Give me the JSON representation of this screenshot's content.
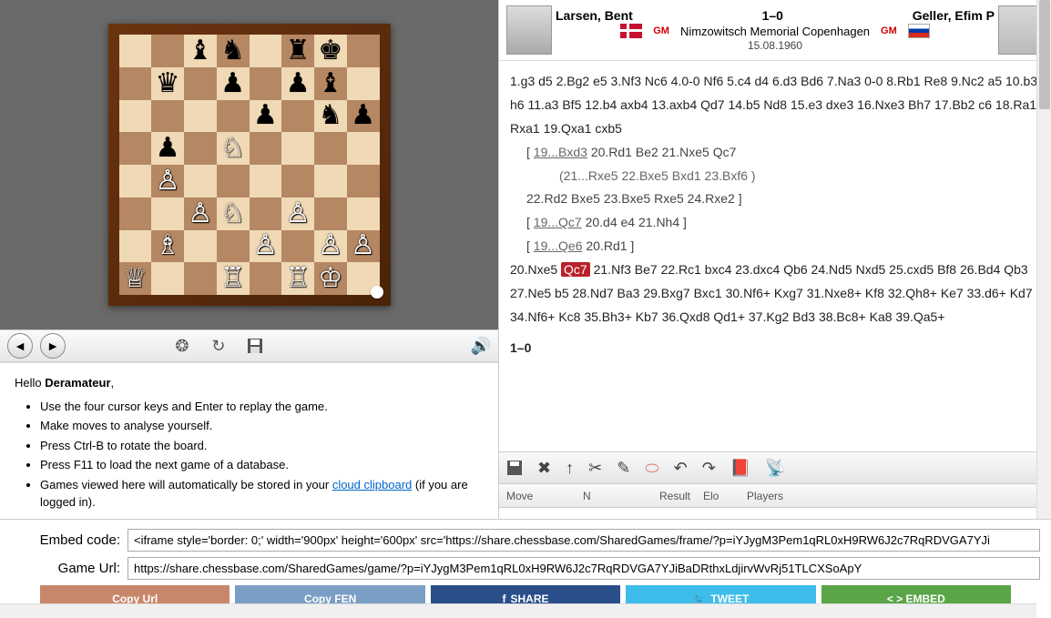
{
  "game": {
    "white": "Larsen, Bent",
    "black": "Geller, Efim P",
    "result": "1–0",
    "event": "Nimzowitsch Memorial Copenhagen",
    "date": "15.08.1960",
    "white_title": "GM",
    "black_title": "GM"
  },
  "board": {
    "fen_rows": [
      "2bn1rk1",
      "1q1p1pb1",
      "4p1np",
      "1p1N4",
      "1P6",
      "2PN1P2",
      "1B2P1PP",
      "Q2R1RK1"
    ]
  },
  "notation": {
    "main": "1.g3 d5 2.Bg2 e5 3.Nf3 Nc6 4.0-0 Nf6 5.c4 d4 6.d3 Bd6 7.Na3 0-0 8.Rb1 Re8 9.Nc2 a5 10.b3 h6 11.a3 Bf5 12.b4 axb4 13.axb4 Qd7 14.b5 Nd8 15.e3 dxe3 16.Nxe3 Bh7 17.Bb2 c6 18.Ra1 Rxa1 19.Qxa1 cxb5",
    "var1_start": "19...Bxd3",
    "var1_rest": "20.Rd1 Be2 21.Nxe5 Qc7",
    "var1_sub": "(21...Rxe5 22.Bxe5 Bxd1 23.Bxf6 )",
    "var1_cont": "22.Rd2 Bxe5 23.Bxe5 Rxe5 24.Rxe2 ]",
    "var2_start": "19...Qc7",
    "var2_rest": "20.d4 e4 21.Nh4 ]",
    "var3_start": "19...Qe6",
    "var3_rest": "20.Rd1 ]",
    "main2_pre": "20.Nxe5",
    "current": "Qc7",
    "main2_post": "21.Nf3 Be7 22.Rc1 bxc4 23.dxc4 Qb6 24.Nd5 Nxd5 25.cxd5 Bf8 26.Bd4 Qb3 27.Ne5 b5 28.Nd7 Ba3 29.Bxg7 Bxc1 30.Nf6+ Kxg7 31.Nxe8+ Kf8 32.Qh8+ Ke7 33.d6+ Kd7 34.Nf6+ Kc8 35.Bh3+ Kb7 36.Qxd8 Qd1+ 37.Kg2 Bd3 38.Bc8+ Ka8 39.Qa5+",
    "result_line": "1–0"
  },
  "info": {
    "hello": "Hello",
    "username": "Deramateur",
    "tips": [
      "Use the four cursor keys and Enter to replay the game.",
      "Make moves to analyse yourself.",
      "Press Ctrl-B to rotate the board.",
      "Press F11 to load the next game of a database."
    ],
    "tip5_pre": "Games viewed here will automatically be stored in your ",
    "tip5_link": "cloud clipboard",
    "tip5_post": " (if you are logged in)."
  },
  "game_list": {
    "col_move": "Move",
    "col_n": "N",
    "col_result": "Result",
    "col_elo": "Elo",
    "col_players": "Players"
  },
  "embed": {
    "code_label": "Embed code:",
    "url_label": "Game Url:",
    "code_value": "<iframe style='border: 0;' width='900px' height='600px' src='https://share.chessbase.com/SharedGames/frame/?p=iYJygM3Pem1qRL0xH9RW6J2c7RqRDVGA7YJi",
    "url_value": "https://share.chessbase.com/SharedGames/game/?p=iYJygM3Pem1qRL0xH9RW6J2c7RqRDVGA7YJiBaDRthxLdjirvWvRj51TLCXSoApY"
  },
  "buttons": {
    "copy_url": "Copy Url",
    "copy_fen": "Copy FEN",
    "share": "SHARE",
    "tweet": "TWEET",
    "embed": "< > EMBED"
  }
}
